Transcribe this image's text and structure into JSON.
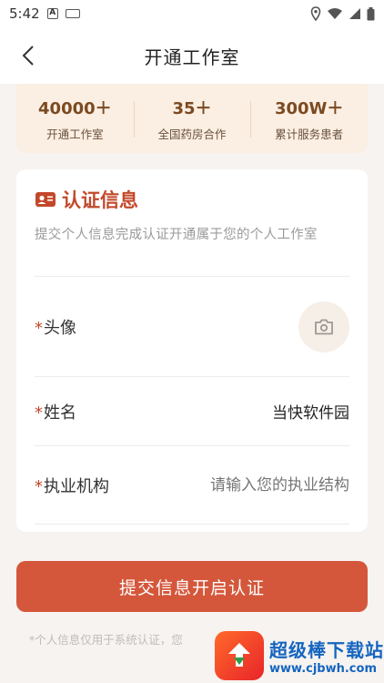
{
  "status_bar": {
    "time": "5:42",
    "icons": [
      "text-notification-icon",
      "keyboard-icon",
      "location-icon",
      "wifi-icon",
      "cellular-icon",
      "battery-icon"
    ]
  },
  "nav": {
    "title": "开通工作室",
    "back_icon": "chevron-left-icon"
  },
  "stats": [
    {
      "value": "40000＋",
      "label": "开通工作室"
    },
    {
      "value": "35＋",
      "label": "全国药房合作"
    },
    {
      "value": "300W＋",
      "label": "累计服务患者"
    }
  ],
  "card": {
    "title": "认证信息",
    "subtitle": "提交个人信息完成认证开通属于您的个人工作室",
    "title_icon": "id-card-icon",
    "fields": {
      "avatar": {
        "required_mark": "*",
        "label": "头像",
        "icon": "camera-icon"
      },
      "name": {
        "required_mark": "*",
        "label": "姓名",
        "value": "当快软件园"
      },
      "institution": {
        "required_mark": "*",
        "label": "执业机构",
        "placeholder": "请输入您的执业结构"
      }
    }
  },
  "submit_label": "提交信息开启认证",
  "note": "*个人信息仅用于系统认证，您",
  "watermark": {
    "title": "超级棒下载站",
    "url": "www.cjbwh.com"
  },
  "colors": {
    "accent": "#d4573b",
    "accent_text": "#c3482a",
    "stats_bg": "#fbeee2",
    "stats_value": "#7a4a22",
    "page_bg": "#f6f3f0"
  }
}
